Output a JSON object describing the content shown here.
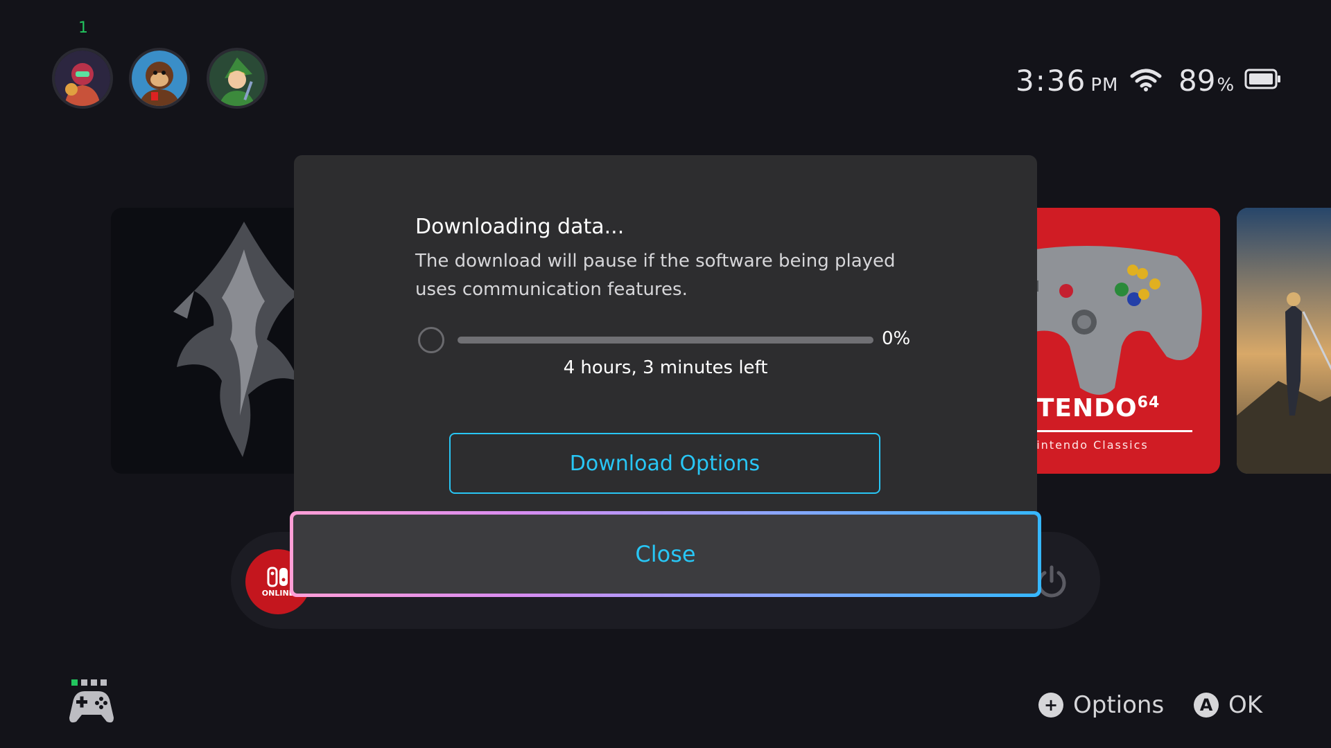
{
  "header": {
    "user_count": "1",
    "avatars": [
      "user-avatar-1",
      "user-avatar-2",
      "user-avatar-3"
    ],
    "time": "3:36",
    "ampm": "PM",
    "battery_value": "89",
    "battery_unit": "%"
  },
  "tiles": {
    "n64": {
      "title": "NTENDO",
      "title_sup": "64",
      "subtitle": "Nintendo Classics"
    }
  },
  "dock": {
    "online_label": "ONLINE"
  },
  "modal": {
    "title": "Downloading data...",
    "message": "The download will pause if the software being played uses communication features.",
    "progress": {
      "fraction": 0,
      "percent_label": "0%"
    },
    "time_left": "4 hours, 3 minutes left",
    "download_options_label": "Download Options",
    "close_label": "Close"
  },
  "footer": {
    "options_glyph": "+",
    "options_label": "Options",
    "ok_glyph": "A",
    "ok_label": "OK"
  },
  "colors": {
    "background": "#131319",
    "modal": "#2d2d2f",
    "accent": "#28c6f5",
    "focus_gradient": [
      "#ff9fd6",
      "#d88cf0",
      "#8aa6ff",
      "#35b7ff"
    ],
    "online_red": "#c4161e",
    "n64_red": "#d01c24"
  }
}
